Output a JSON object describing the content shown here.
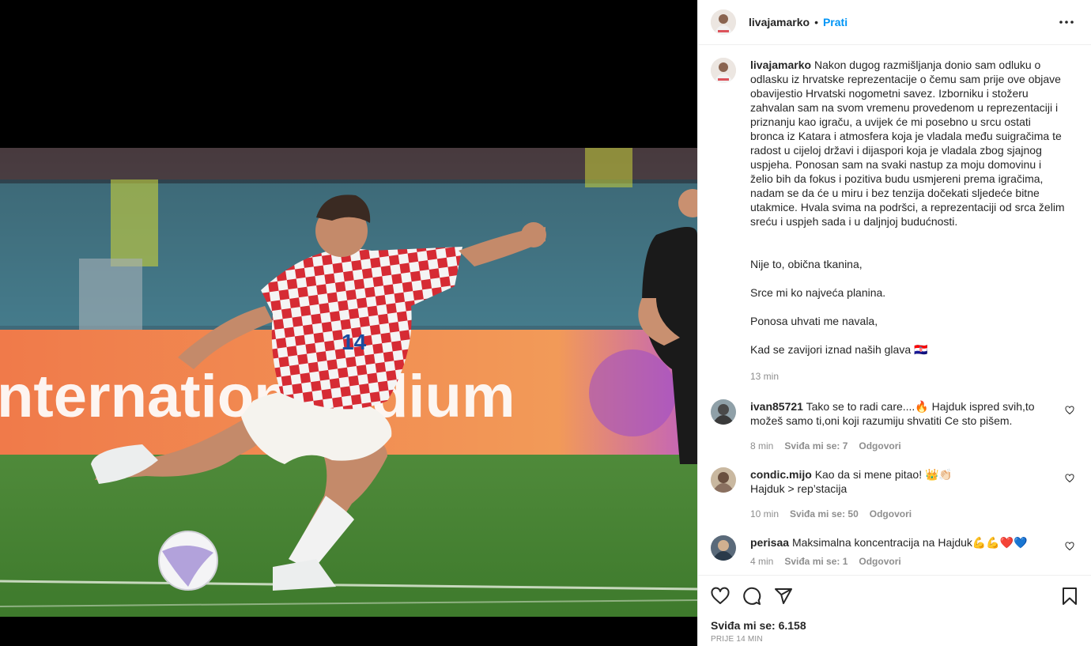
{
  "post": {
    "username": "livajamarko",
    "follow_label": "Prati",
    "dot": "•",
    "caption_username": "livajamarko",
    "caption_text": "Nakon dugog razmišljanja donio sam odluku o odlasku iz hrvatske reprezentacije o čemu sam prije ove objave obavijestio Hrvatski nogometni savez. Izborniku i stožeru zahvalan sam na svom vremenu provedenom u reprezentaciji i priznanju kao igraču, a uvijek će mi posebno u srcu ostati bronca iz Katara i atmosfera koja je vladala među suigračima te radost u cijeloj državi i dijaspori koja je vladala zbog sjajnog uspjeha. Ponosan sam na svaki nastup za moju domovinu i želio bih da fokus i pozitiva budu usmjereni prema igračima, nadam se da će u miru i bez tenzija dočekati sljedeće bitne utakmice. Hvala svima na podršci, a reprezentaciji od srca želim sreću i uspjeh sada i u daljnjoj budućnosti.",
    "poem_1": "Nije to, obična tkanina,",
    "poem_2": "Srce mi ko najveća planina.",
    "poem_3": "Ponosa uhvati me navala,",
    "poem_4": "Kad se zavijori iznad naših glava 🇭🇷",
    "caption_time": "13 min"
  },
  "comments": [
    {
      "username": "ivan85721",
      "text": "Tako se to radi care....🔥 Hajduk ispred svih,to možeš samo ti,oni koji razumiju shvatiti Ce sto pišem.",
      "time": "8 min",
      "likes": "Sviđa mi se: 7",
      "reply": "Odgovori"
    },
    {
      "username": "condic.mijo",
      "text": "Kao da si mene pitao! 👑👏🏻\nHajduk > rep’stacija",
      "time": "10 min",
      "likes": "Sviđa mi se: 50",
      "reply": "Odgovori"
    },
    {
      "username": "perisaa",
      "text": "Maksimalna koncentracija na Hajduk💪💪❤️💙",
      "time": "4 min",
      "likes": "Sviđa mi se: 1",
      "reply": "Odgovori"
    }
  ],
  "footer": {
    "likes": "Sviđa mi se: 6.158",
    "ago": "PRIJE 14 MIN"
  },
  "photo": {
    "stadium_text": "nternational",
    "stadium_text_2": "dium",
    "jersey_number": "14"
  },
  "icons": [
    "more-icon",
    "heart-icon",
    "comment-icon",
    "share-icon",
    "bookmark-icon",
    "small-heart-icon"
  ],
  "colors": {
    "accent": "#0095f6",
    "muted": "#8e8e8e",
    "text": "#262626"
  }
}
